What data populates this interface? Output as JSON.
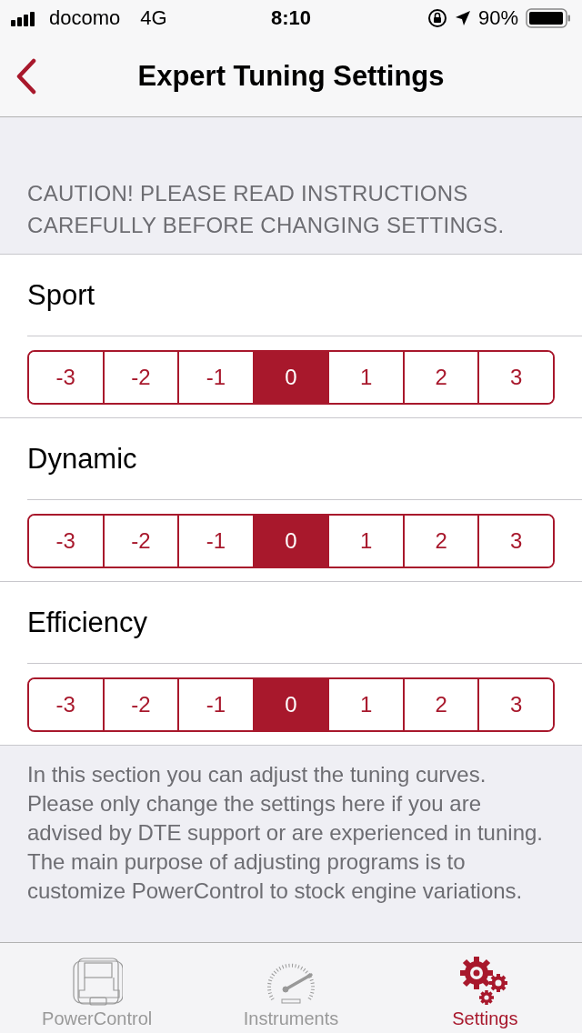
{
  "status_bar": {
    "carrier": "docomo",
    "network": "4G",
    "time": "8:10",
    "battery": "90%"
  },
  "nav": {
    "title": "Expert Tuning Settings"
  },
  "caution": "CAUTION! PLEASE READ INSTRUCTIONS CAREFULLY BEFORE CHANGING SETTINGS.",
  "modes": [
    {
      "label": "Sport",
      "options": [
        {
          "label": "-3",
          "selected": false
        },
        {
          "label": "-2",
          "selected": false
        },
        {
          "label": "-1",
          "selected": false
        },
        {
          "label": "0",
          "selected": true
        },
        {
          "label": "1",
          "selected": false
        },
        {
          "label": "2",
          "selected": false
        },
        {
          "label": "3",
          "selected": false
        }
      ]
    },
    {
      "label": "Dynamic",
      "options": [
        {
          "label": "-3",
          "selected": false
        },
        {
          "label": "-2",
          "selected": false
        },
        {
          "label": "-1",
          "selected": false
        },
        {
          "label": "0",
          "selected": true
        },
        {
          "label": "1",
          "selected": false
        },
        {
          "label": "2",
          "selected": false
        },
        {
          "label": "3",
          "selected": false
        }
      ]
    },
    {
      "label": "Efficiency",
      "options": [
        {
          "label": "-3",
          "selected": false
        },
        {
          "label": "-2",
          "selected": false
        },
        {
          "label": "-1",
          "selected": false
        },
        {
          "label": "0",
          "selected": true
        },
        {
          "label": "1",
          "selected": false
        },
        {
          "label": "2",
          "selected": false
        },
        {
          "label": "3",
          "selected": false
        }
      ]
    }
  ],
  "footer_note": "In this section you can adjust the tuning curves. Please only change the settings here if you are advised by DTE support or are experienced in tuning. The main purpose of adjusting programs is to customize PowerControl to stock engine variations.",
  "tab_bar": [
    {
      "label": "PowerControl",
      "kind": "module",
      "selected": false
    },
    {
      "label": "Instruments",
      "kind": "gauge",
      "selected": false
    },
    {
      "label": "Settings",
      "kind": "gears",
      "selected": true
    }
  ]
}
